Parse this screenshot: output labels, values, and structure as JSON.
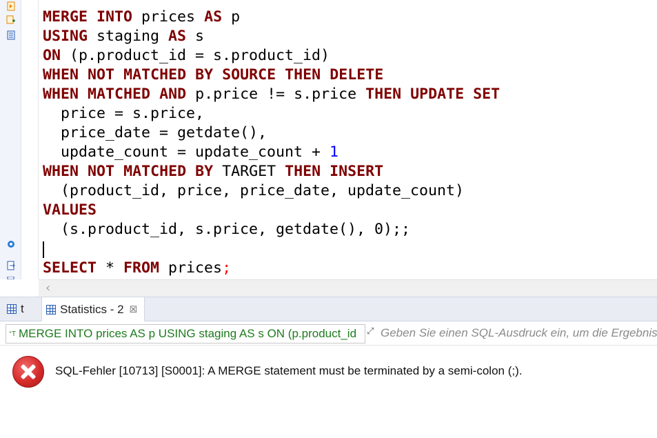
{
  "editor": {
    "lines": [
      [
        {
          "t": "MERGE",
          "k": 1
        },
        {
          "t": " "
        },
        {
          "t": "INTO",
          "k": 1
        },
        {
          "t": " prices "
        },
        {
          "t": "AS",
          "k": 1
        },
        {
          "t": " p"
        }
      ],
      [
        {
          "t": "USING",
          "k": 1
        },
        {
          "t": " staging "
        },
        {
          "t": "AS",
          "k": 1
        },
        {
          "t": " s"
        }
      ],
      [
        {
          "t": "ON",
          "k": 1
        },
        {
          "t": " (p.product_id = s.product_id)"
        }
      ],
      [
        {
          "t": "WHEN",
          "k": 1
        },
        {
          "t": " "
        },
        {
          "t": "NOT",
          "k": 1
        },
        {
          "t": " "
        },
        {
          "t": "MATCHED",
          "k": 1
        },
        {
          "t": " "
        },
        {
          "t": "BY",
          "k": 1
        },
        {
          "t": " "
        },
        {
          "t": "SOURCE",
          "k": 1
        },
        {
          "t": " "
        },
        {
          "t": "THEN",
          "k": 1
        },
        {
          "t": " "
        },
        {
          "t": "DELETE",
          "k": 1
        }
      ],
      [
        {
          "t": "WHEN",
          "k": 1
        },
        {
          "t": " "
        },
        {
          "t": "MATCHED",
          "k": 1
        },
        {
          "t": " "
        },
        {
          "t": "AND",
          "k": 1
        },
        {
          "t": " p.price != s.price "
        },
        {
          "t": "THEN",
          "k": 1
        },
        {
          "t": " "
        },
        {
          "t": "UPDATE",
          "k": 1
        },
        {
          "t": " "
        },
        {
          "t": "SET",
          "k": 1
        }
      ],
      [
        {
          "t": "  price = s.price,"
        }
      ],
      [
        {
          "t": "  price_date = getdate(),"
        }
      ],
      [
        {
          "t": "  update_count = update_count + "
        },
        {
          "t": "1",
          "n": 1
        }
      ],
      [
        {
          "t": "WHEN",
          "k": 1
        },
        {
          "t": " "
        },
        {
          "t": "NOT",
          "k": 1
        },
        {
          "t": " "
        },
        {
          "t": "MATCHED",
          "k": 1
        },
        {
          "t": " "
        },
        {
          "t": "BY",
          "k": 1
        },
        {
          "t": " TARGET "
        },
        {
          "t": "THEN",
          "k": 1
        },
        {
          "t": " "
        },
        {
          "t": "INSERT",
          "k": 1
        }
      ],
      [
        {
          "t": "  (product_id, price, price_date, update_count)"
        }
      ],
      [
        {
          "t": "VALUES",
          "k": 1
        }
      ],
      [
        {
          "t": "  (s.product_id, s.price, getdate(), 0);;",
          "sel": 1
        }
      ],
      [
        {
          "t": ""
        }
      ],
      [
        {
          "t": "SELECT",
          "k": 1
        },
        {
          "t": " * "
        },
        {
          "t": "FROM",
          "k": 1
        },
        {
          "t": " prices"
        },
        {
          "t": ";",
          "r": 1
        }
      ]
    ]
  },
  "tabs": {
    "t_label": "t",
    "stats_label": "Statistics - 2",
    "close_glyph": "☒"
  },
  "filter": {
    "query_text": "MERGE INTO prices AS p USING staging AS s ON (p.product_id",
    "placeholder": "Geben Sie einen SQL-Ausdruck ein, um die Ergebnis"
  },
  "error": {
    "message": "SQL-Fehler [10713] [S0001]: A MERGE statement must be terminated by a semi-colon (;)."
  },
  "colors": {
    "keyword": "#7f0000",
    "selection": "#0078d7",
    "query_green": "#1e7b1e"
  },
  "icons": [
    "script-run-icon",
    "script-explain-icon",
    "script-list-icon",
    "settings-gear-icon",
    "export-icon",
    "import-error-icon",
    "grid-icon",
    "close-icon",
    "query-icon",
    "expand-icon",
    "error-icon",
    "scroll-left-icon"
  ]
}
